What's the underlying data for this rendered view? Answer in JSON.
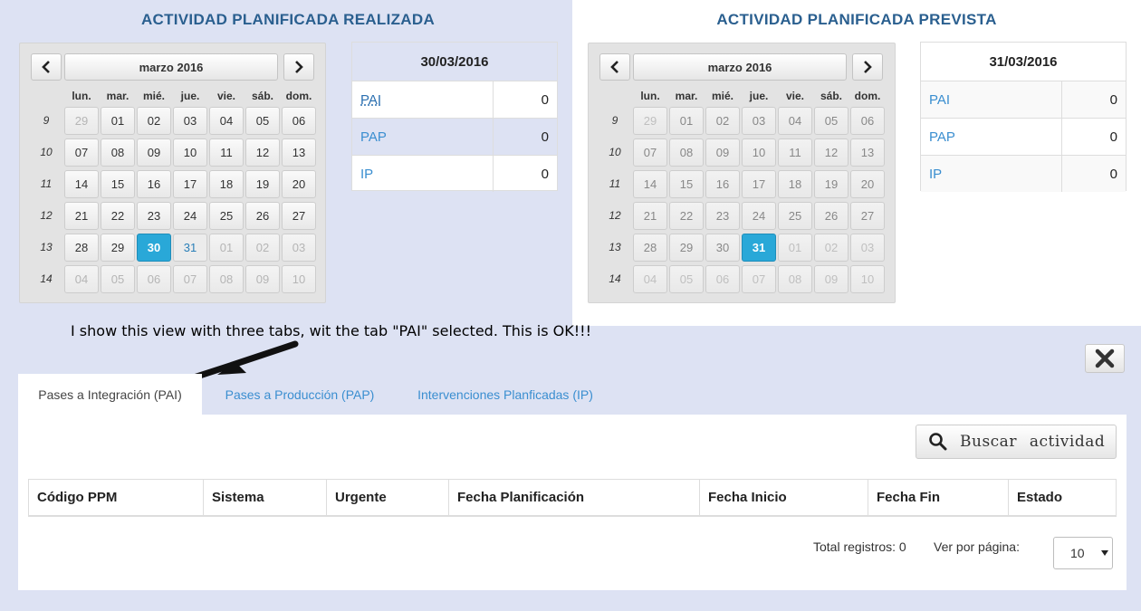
{
  "left": {
    "title": "ACTIVIDAD PLANIFICADA REALIZADA",
    "calendar": {
      "prev": "‹",
      "next": "›",
      "month": "marzo 2016",
      "weekdays": [
        "lun.",
        "mar.",
        "mié.",
        "jue.",
        "vie.",
        "sáb.",
        "dom."
      ],
      "weeks": [
        {
          "num": "9",
          "days": [
            "29",
            "01",
            "02",
            "03",
            "04",
            "05",
            "06"
          ]
        },
        {
          "num": "10",
          "days": [
            "07",
            "08",
            "09",
            "10",
            "11",
            "12",
            "13"
          ]
        },
        {
          "num": "11",
          "days": [
            "14",
            "15",
            "16",
            "17",
            "18",
            "19",
            "20"
          ]
        },
        {
          "num": "12",
          "days": [
            "21",
            "22",
            "23",
            "24",
            "25",
            "26",
            "27"
          ]
        },
        {
          "num": "13",
          "days": [
            "28",
            "29",
            "30",
            "31",
            "01",
            "02",
            "03"
          ]
        },
        {
          "num": "14",
          "days": [
            "04",
            "05",
            "06",
            "07",
            "08",
            "09",
            "10"
          ]
        }
      ],
      "selected_day": "30"
    },
    "summary": {
      "date": "30/03/2016",
      "rows": [
        {
          "label": "PAI",
          "value": "0"
        },
        {
          "label": "PAP",
          "value": "0"
        },
        {
          "label": "IP",
          "value": "0"
        }
      ]
    }
  },
  "right": {
    "title": "ACTIVIDAD PLANIFICADA PREVISTA",
    "calendar": {
      "prev": "‹",
      "next": "›",
      "month": "marzo 2016",
      "weekdays": [
        "lun.",
        "mar.",
        "mié.",
        "jue.",
        "vie.",
        "sáb.",
        "dom."
      ],
      "weeks": [
        {
          "num": "9",
          "days": [
            "29",
            "01",
            "02",
            "03",
            "04",
            "05",
            "06"
          ]
        },
        {
          "num": "10",
          "days": [
            "07",
            "08",
            "09",
            "10",
            "11",
            "12",
            "13"
          ]
        },
        {
          "num": "11",
          "days": [
            "14",
            "15",
            "16",
            "17",
            "18",
            "19",
            "20"
          ]
        },
        {
          "num": "12",
          "days": [
            "21",
            "22",
            "23",
            "24",
            "25",
            "26",
            "27"
          ]
        },
        {
          "num": "13",
          "days": [
            "28",
            "29",
            "30",
            "31",
            "01",
            "02",
            "03"
          ]
        },
        {
          "num": "14",
          "days": [
            "04",
            "05",
            "06",
            "07",
            "08",
            "09",
            "10"
          ]
        }
      ],
      "selected_day": "31"
    },
    "summary": {
      "date": "31/03/2016",
      "rows": [
        {
          "label": "PAI",
          "value": "0"
        },
        {
          "label": "PAP",
          "value": "0"
        },
        {
          "label": "IP",
          "value": "0"
        }
      ]
    }
  },
  "annotation": "I show this view with three tabs, wit the tab \"PAI\" selected. This is OK!!!",
  "tabs": [
    {
      "label": "Pases a Integración (PAI)",
      "active": true
    },
    {
      "label": "Pases a Producción (PAP)",
      "active": false
    },
    {
      "label": "Intervenciones Planficadas (IP)",
      "active": false
    }
  ],
  "search_button": "Buscar actividad",
  "table": {
    "columns": [
      "Código PPM",
      "Sistema",
      "Urgente",
      "Fecha Planificación",
      "Fecha Inicio",
      "Fecha Fin",
      "Estado"
    ]
  },
  "footer": {
    "total_label": "Total registros: 0",
    "per_page_label": "Ver por página:",
    "per_page_value": "10"
  },
  "colors": {
    "background": "#dde2f3",
    "title": "#2a5f8f",
    "link": "#3a8ed0",
    "selected_day": "#29a8d8"
  },
  "icons": {
    "close": "close-icon",
    "search": "search-icon",
    "prev": "chevron-left-icon",
    "next": "chevron-right-icon",
    "select": "caret-down-icon"
  }
}
